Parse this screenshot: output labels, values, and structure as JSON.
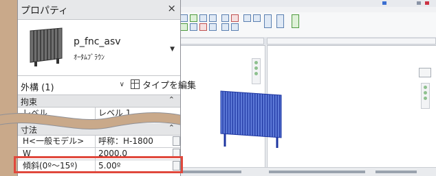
{
  "properties_palette": {
    "title": "プロパティ",
    "close_symbol": "×",
    "type_selector": {
      "name": "p_fnc_asv",
      "subtitle": "ｵｰﾀﾑﾌﾞﾗｳﾝ",
      "dropdown_icon": "triangle-down-icon"
    },
    "filter": {
      "label": "外構 (1)",
      "dropdown_icon": "chevron-down-icon"
    },
    "edit_type_label": "タイプを編集",
    "sections": {
      "constraints": {
        "label": "拘束",
        "collapse_symbol": "⌃",
        "row": {
          "name": "レベル",
          "value": "レベル 1"
        }
      },
      "dimensions": {
        "label": "寸法",
        "collapse_symbol": "⌃",
        "rows": [
          {
            "name": "H<一般モデル>",
            "value": "呼称：H-1800"
          },
          {
            "name": "W",
            "value": "2000.0"
          },
          {
            "name": "傾斜(0º〜15º)",
            "value": "5.00º"
          }
        ]
      }
    }
  },
  "colors": {
    "highlight": "#e0483c",
    "fence": "#2b48b8",
    "background": "#c9a98a"
  }
}
